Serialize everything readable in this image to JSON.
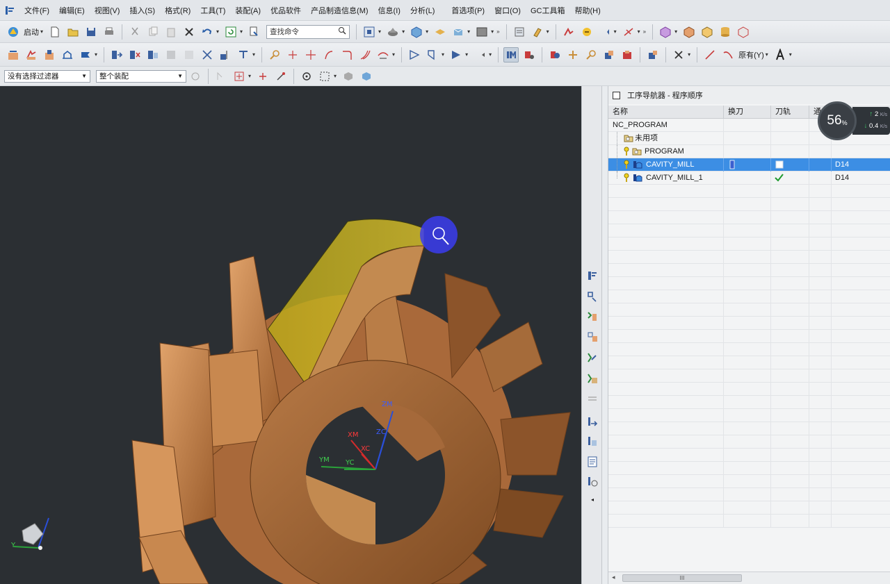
{
  "menu": [
    "文件(F)",
    "编辑(E)",
    "视图(V)",
    "插入(S)",
    "格式(R)",
    "工具(T)",
    "装配(A)",
    "优品软件",
    "产品制造信息(M)",
    "信息(I)",
    "分析(L)",
    "首选项(P)",
    "窗口(O)",
    "GC工具箱",
    "帮助(H)"
  ],
  "toolbar": {
    "start_label": "启动",
    "search_placeholder": "查找命令",
    "existing_label": "原有(Y)",
    "selection_filter": "没有选择过滤器",
    "assembly_scope": "整个装配"
  },
  "viewport": {
    "axes": {
      "zm": "ZM",
      "zc": "ZC",
      "xm": "XM",
      "xc": "XC",
      "ym": "YM",
      "yc": "YC"
    },
    "triad": {
      "y": "Y"
    },
    "colors": {
      "background": "#2b2f33",
      "part": "#c4844d",
      "highlight": "#c7b51c",
      "zoom_cursor": "#3b3cf0"
    }
  },
  "navigator": {
    "title": "工序导航器 - 程序顺序",
    "columns": [
      "名称",
      "换刀",
      "刀轨",
      "通"
    ],
    "rows": [
      {
        "name": "NC_PROGRAM",
        "tool": ""
      },
      {
        "name": "未用项",
        "tool": ""
      },
      {
        "name": "PROGRAM",
        "tool": ""
      },
      {
        "name": "CAVITY_MILL",
        "tool": "D14",
        "selected": true
      },
      {
        "name": "CAVITY_MILL_1",
        "tool": "D14"
      }
    ]
  },
  "speed_widget": {
    "percent": "56",
    "unit": "%",
    "up": "2",
    "up_unit": "K/s",
    "down": "0.4",
    "down_unit": "K/s"
  },
  "scrollbar_grip": "III"
}
